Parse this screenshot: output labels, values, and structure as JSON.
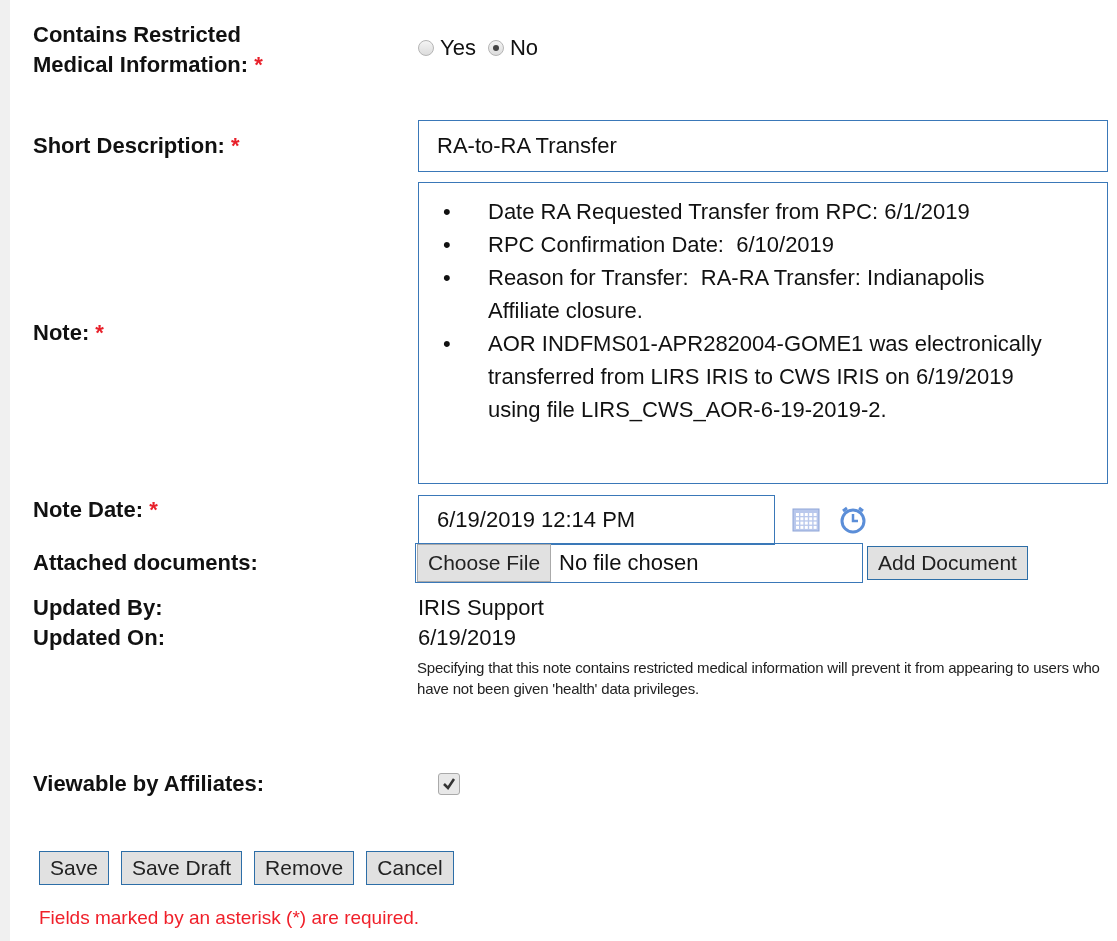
{
  "fields": [
    {
      "kind": "radio",
      "label": "Contains Restricted Medical Information:",
      "asterisk": "*",
      "options": [
        {
          "label": "Yes",
          "selected": false
        },
        {
          "label": "No",
          "selected": true
        }
      ]
    },
    {
      "kind": "text",
      "label": "Short Description:",
      "asterisk": "*",
      "value": "RA-to-RA Transfer"
    },
    {
      "kind": "note",
      "label": "Note:",
      "asterisk": "*",
      "bullets": [
        {
          "marker": "•",
          "text": "Date RA Requested Transfer from RPC: 6/1/2019"
        },
        {
          "marker": "•",
          "text": "RPC Confirmation Date:  6/10/2019"
        },
        {
          "marker": "•",
          "text": "Reason for Transfer:  RA-RA Transfer: Indianapolis Affiliate closure."
        },
        {
          "marker": "•",
          "text": "AOR INDFMS01-APR282004-GOME1 was electronically transferred from LIRS IRIS to CWS IRIS on 6/19/2019 using file LIRS_CWS_AOR-6-19-2019-2."
        }
      ]
    },
    {
      "kind": "datetime",
      "label": "Note Date:",
      "asterisk": "*",
      "value": "6/19/2019 12:14 PM"
    },
    {
      "kind": "file",
      "label": "Attached documents:",
      "choose": "Choose File",
      "status": "No file chosen",
      "add": "Add Document"
    },
    {
      "kind": "static",
      "label": "Updated By:",
      "value": "IRIS Support"
    },
    {
      "kind": "static",
      "label": "Updated On:",
      "value": "6/19/2019"
    }
  ],
  "disclaimer": "Specifying that this note contains restricted medical information will prevent it from appearing to users who have not been given 'health' data privileges.",
  "viewable": {
    "label": "Viewable by Affiliates:",
    "checked": true
  },
  "buttons": [
    "Save",
    "Save Draft",
    "Remove",
    "Cancel"
  ],
  "footnote": "Fields marked by an asterisk (*) are required."
}
